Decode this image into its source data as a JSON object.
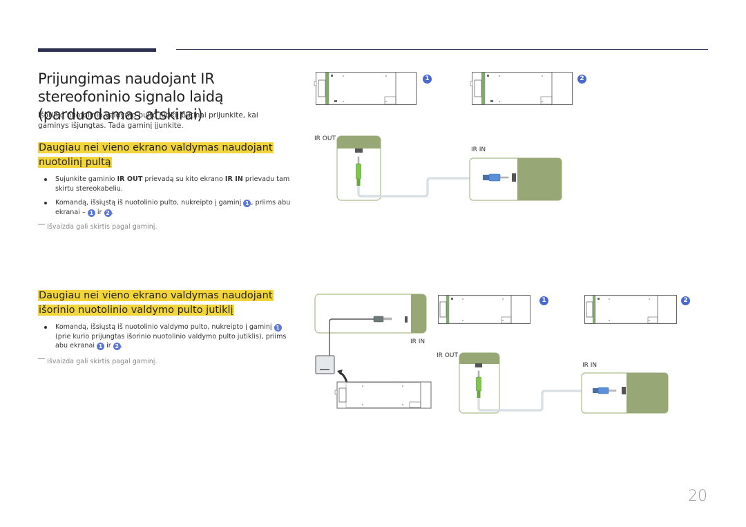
{
  "page": {
    "number": "20"
  },
  "title": "Prijungimas naudojant IR stereofoninio signalo laidą (parduodamas atskirai)",
  "intro": "Išorinio nuotolinio valdymo pulto jutiklį būtinai prijunkite, kai gaminys išjungtas. Tada gaminį įjunkite.",
  "section1": {
    "heading": "Daugiau nei vieno ekrano valdymas naudojant nuotolinį pultą",
    "bullet1": {
      "pre": "Sujunkite gaminio ",
      "bold1": "IR OUT",
      "mid": " prievadą su kito ekrano ",
      "bold2": "IR IN",
      "post": " prievadu tam skirtu stereokabeliu."
    },
    "bullet2": {
      "pre": "Komandą, išsiųstą iš nuotolinio pulto, nukreipto į gaminį ",
      "mid": ", priims abu ekranai – ",
      "and": " ir ",
      "post": "."
    },
    "note": "Išvaizda gali skirtis pagal gaminį."
  },
  "section2": {
    "heading": "Daugiau nei vieno ekrano valdymas naudojant išorinio nuotolinio valdymo pulto jutiklį",
    "bullet1": {
      "pre": "Komandą, išsiųstą iš nuotolinio valdymo pulto, nukreipto į gaminį ",
      "mid": " (prie kurio prijungtas išorinio nuotolinio valdymo pulto jutiklis), priims abu ekranai ",
      "and": " ir ",
      "post": "."
    },
    "note": "Išvaizda gali skirtis pagal gaminį."
  },
  "badges": {
    "one": "1",
    "two": "2"
  },
  "diagram": {
    "ir_out": "IR OUT",
    "ir_in": "IR IN",
    "colors": {
      "port_panel": "#97a876",
      "panel_border": "#a8bd8a",
      "plug_green": "#7ec74a",
      "plug_blue": "#5b8fd8",
      "cable": "#c9d3d8",
      "badge": "#4a69cf"
    }
  }
}
